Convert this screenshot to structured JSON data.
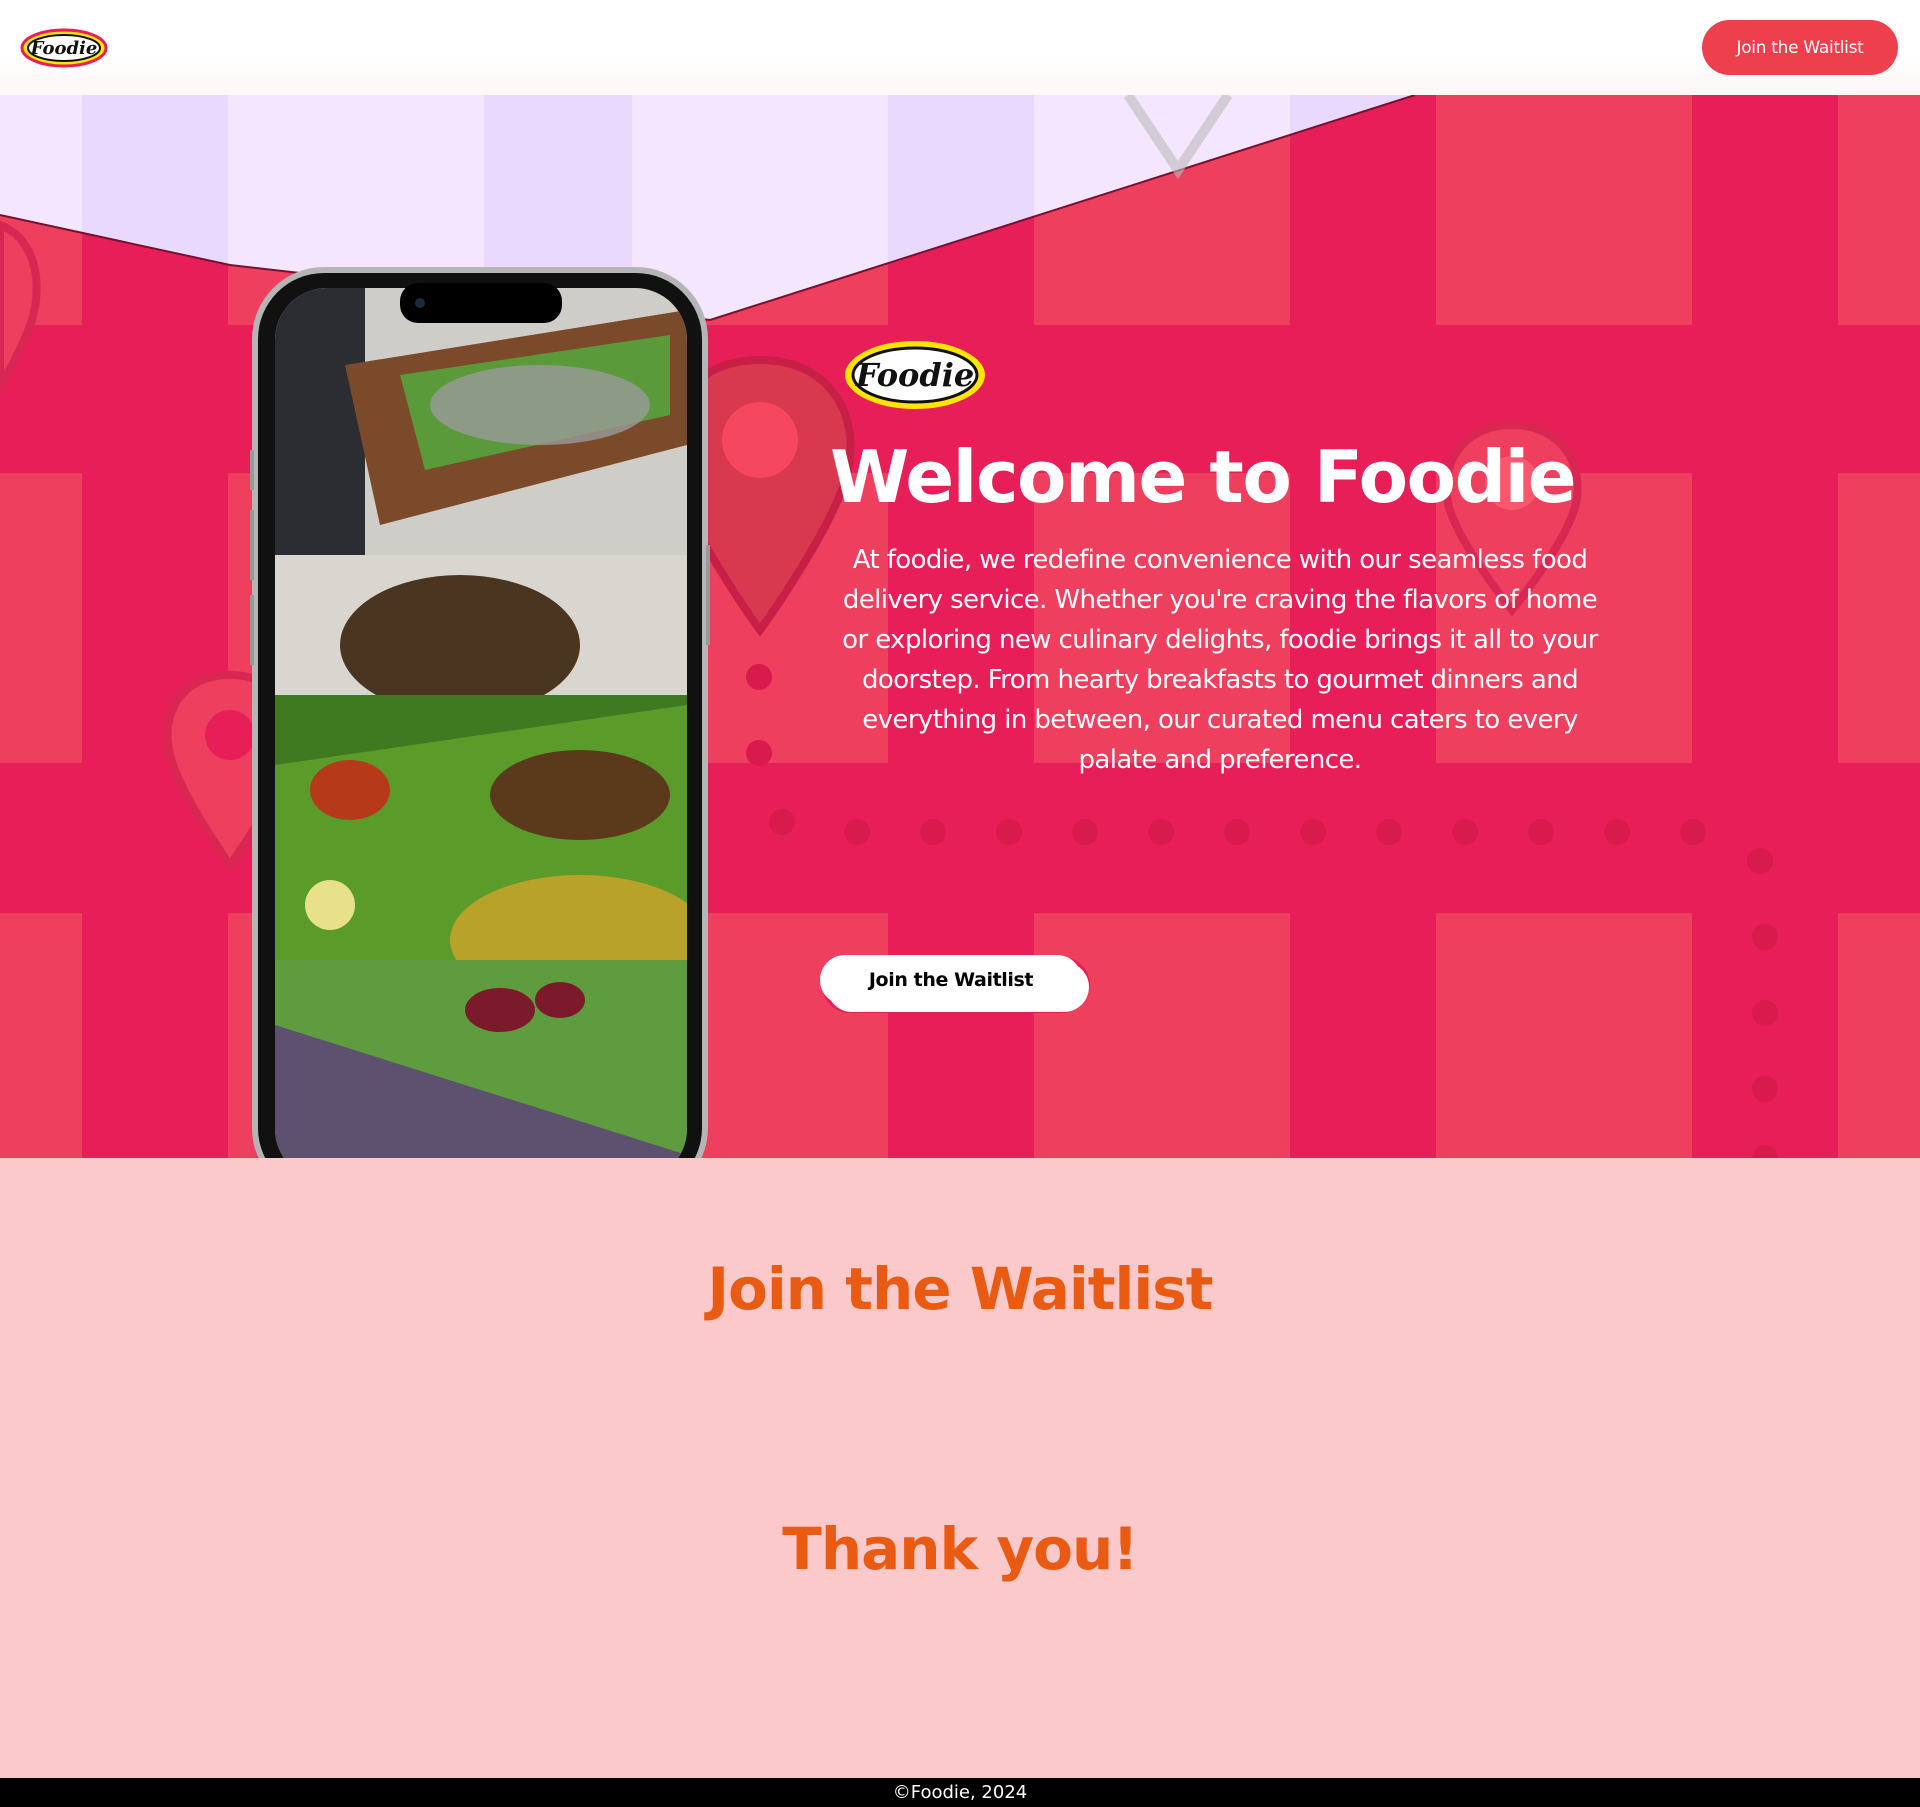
{
  "header": {
    "logo_text": "Foodie",
    "cta_label": "Join the Waitlist"
  },
  "hero": {
    "logo_text": "Foodie",
    "title": "Welcome to Foodie",
    "description": "At foodie, we redefine convenience with our seamless food delivery service. Whether you're craving the flavors of home or exploring new culinary delights, foodie brings it all to your doorstep. From hearty breakfasts to gourmet dinners and everything in between, our curated menu caters to every palate and preference.",
    "cta_label": "Join the Waitlist"
  },
  "waitlist": {
    "title": "Join the Waitlist",
    "thanks": "Thank you!"
  },
  "footer": {
    "copyright": "©Foodie, 2024"
  },
  "colors": {
    "brand_red": "#e81e59",
    "button_red": "#ee3f4d",
    "lavender": "#f3e6fe",
    "section_pink": "#fbc9ca",
    "heading_orange": "#e95a13",
    "footer_black": "#000000"
  },
  "icons": [
    "map-pin-icon",
    "foodie-logo",
    "phone-mockup"
  ]
}
